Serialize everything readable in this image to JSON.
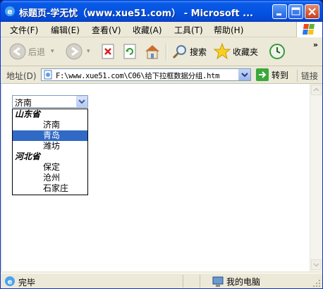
{
  "window": {
    "title": "标题页-学无忧（www.xue51.com） - Microsoft ..."
  },
  "menu": {
    "items": [
      "文件(F)",
      "编辑(E)",
      "查看(V)",
      "收藏(A)",
      "工具(T)",
      "帮助(H)"
    ]
  },
  "toolbar": {
    "back_label": "后退",
    "search_label": "搜索",
    "favorites_label": "收藏夹",
    "more": "»"
  },
  "address_bar": {
    "label": "地址(D)",
    "url": "F:\\www.xue51.com\\C06\\给下拉框数据分组.htm",
    "go_label": "转到",
    "links_label": "链接"
  },
  "select": {
    "value": "济南",
    "options": [
      {
        "label": "山东省",
        "group": true
      },
      {
        "label": "济南",
        "group": false,
        "selected": false
      },
      {
        "label": "青岛",
        "group": false,
        "selected": true
      },
      {
        "label": "潍坊",
        "group": false,
        "selected": false
      },
      {
        "label": "河北省",
        "group": true
      },
      {
        "label": "保定",
        "group": false,
        "selected": false
      },
      {
        "label": "沧州",
        "group": false,
        "selected": false
      },
      {
        "label": "石家庄",
        "group": false,
        "selected": false
      }
    ]
  },
  "status": {
    "text": "完毕",
    "zone": "我的电脑"
  },
  "colors": {
    "titlebar": "#0554e3",
    "selection": "#316ac5",
    "chrome": "#ece9d8"
  },
  "icons": [
    "ie-icon",
    "minimize-icon",
    "maximize-icon",
    "close-icon",
    "windows-logo-icon",
    "back-icon",
    "forward-icon",
    "stop-icon",
    "refresh-icon",
    "home-icon",
    "search-icon",
    "favorites-star-icon",
    "history-icon",
    "page-icon",
    "go-arrow-icon",
    "computer-icon"
  ]
}
